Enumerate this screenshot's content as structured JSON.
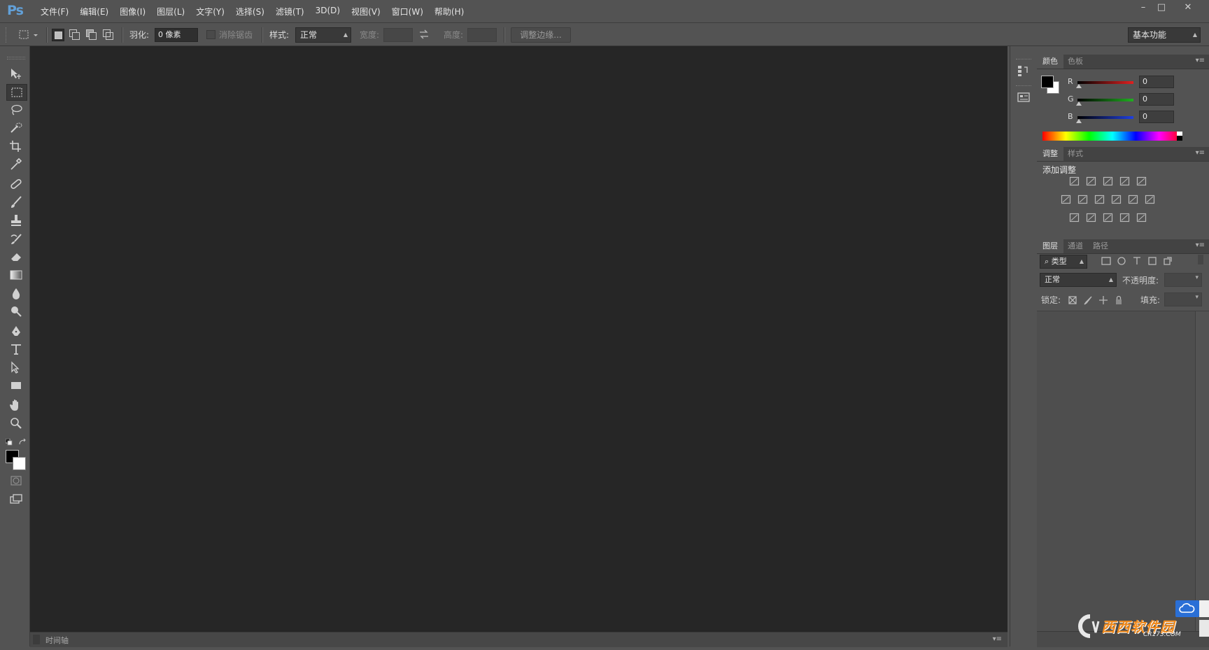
{
  "app": {
    "logo": "Ps"
  },
  "menu": [
    "文件(F)",
    "编辑(E)",
    "图像(I)",
    "图层(L)",
    "文字(Y)",
    "选择(S)",
    "滤镜(T)",
    "3D(D)",
    "视图(V)",
    "窗口(W)",
    "帮助(H)"
  ],
  "window_controls": {
    "minimize": "–",
    "maximize": "□",
    "close": "✕"
  },
  "options": {
    "feather_label": "羽化:",
    "feather_value": "0 像素",
    "antialias_label": "消除锯齿",
    "style_label": "样式:",
    "style_value": "正常",
    "width_label": "宽度:",
    "height_label": "高度:",
    "refine_edge": "调整边缘...",
    "workspace": "基本功能"
  },
  "timeline": {
    "label": "时间轴"
  },
  "color_panel": {
    "tabs": [
      "颜色",
      "色板"
    ],
    "channels": [
      {
        "name": "R",
        "value": "0",
        "color": "#e02020"
      },
      {
        "name": "G",
        "value": "0",
        "color": "#20b020"
      },
      {
        "name": "B",
        "value": "0",
        "color": "#2040e0"
      }
    ]
  },
  "adjust_panel": {
    "tabs": [
      "调整",
      "样式"
    ],
    "title": "添加调整"
  },
  "layers_panel": {
    "tabs": [
      "图层",
      "通道",
      "路径"
    ],
    "filter": "类型",
    "blend_mode": "正常",
    "opacity_label": "不透明度:",
    "lock_label": "锁定:",
    "fill_label": "填充:"
  },
  "colors": {
    "foreground": "#000000",
    "background": "#ffffff",
    "canvas": "#262626",
    "chrome": "#535353"
  },
  "watermark": {
    "text": "西西软件园",
    "sub": "CR173.COM"
  }
}
